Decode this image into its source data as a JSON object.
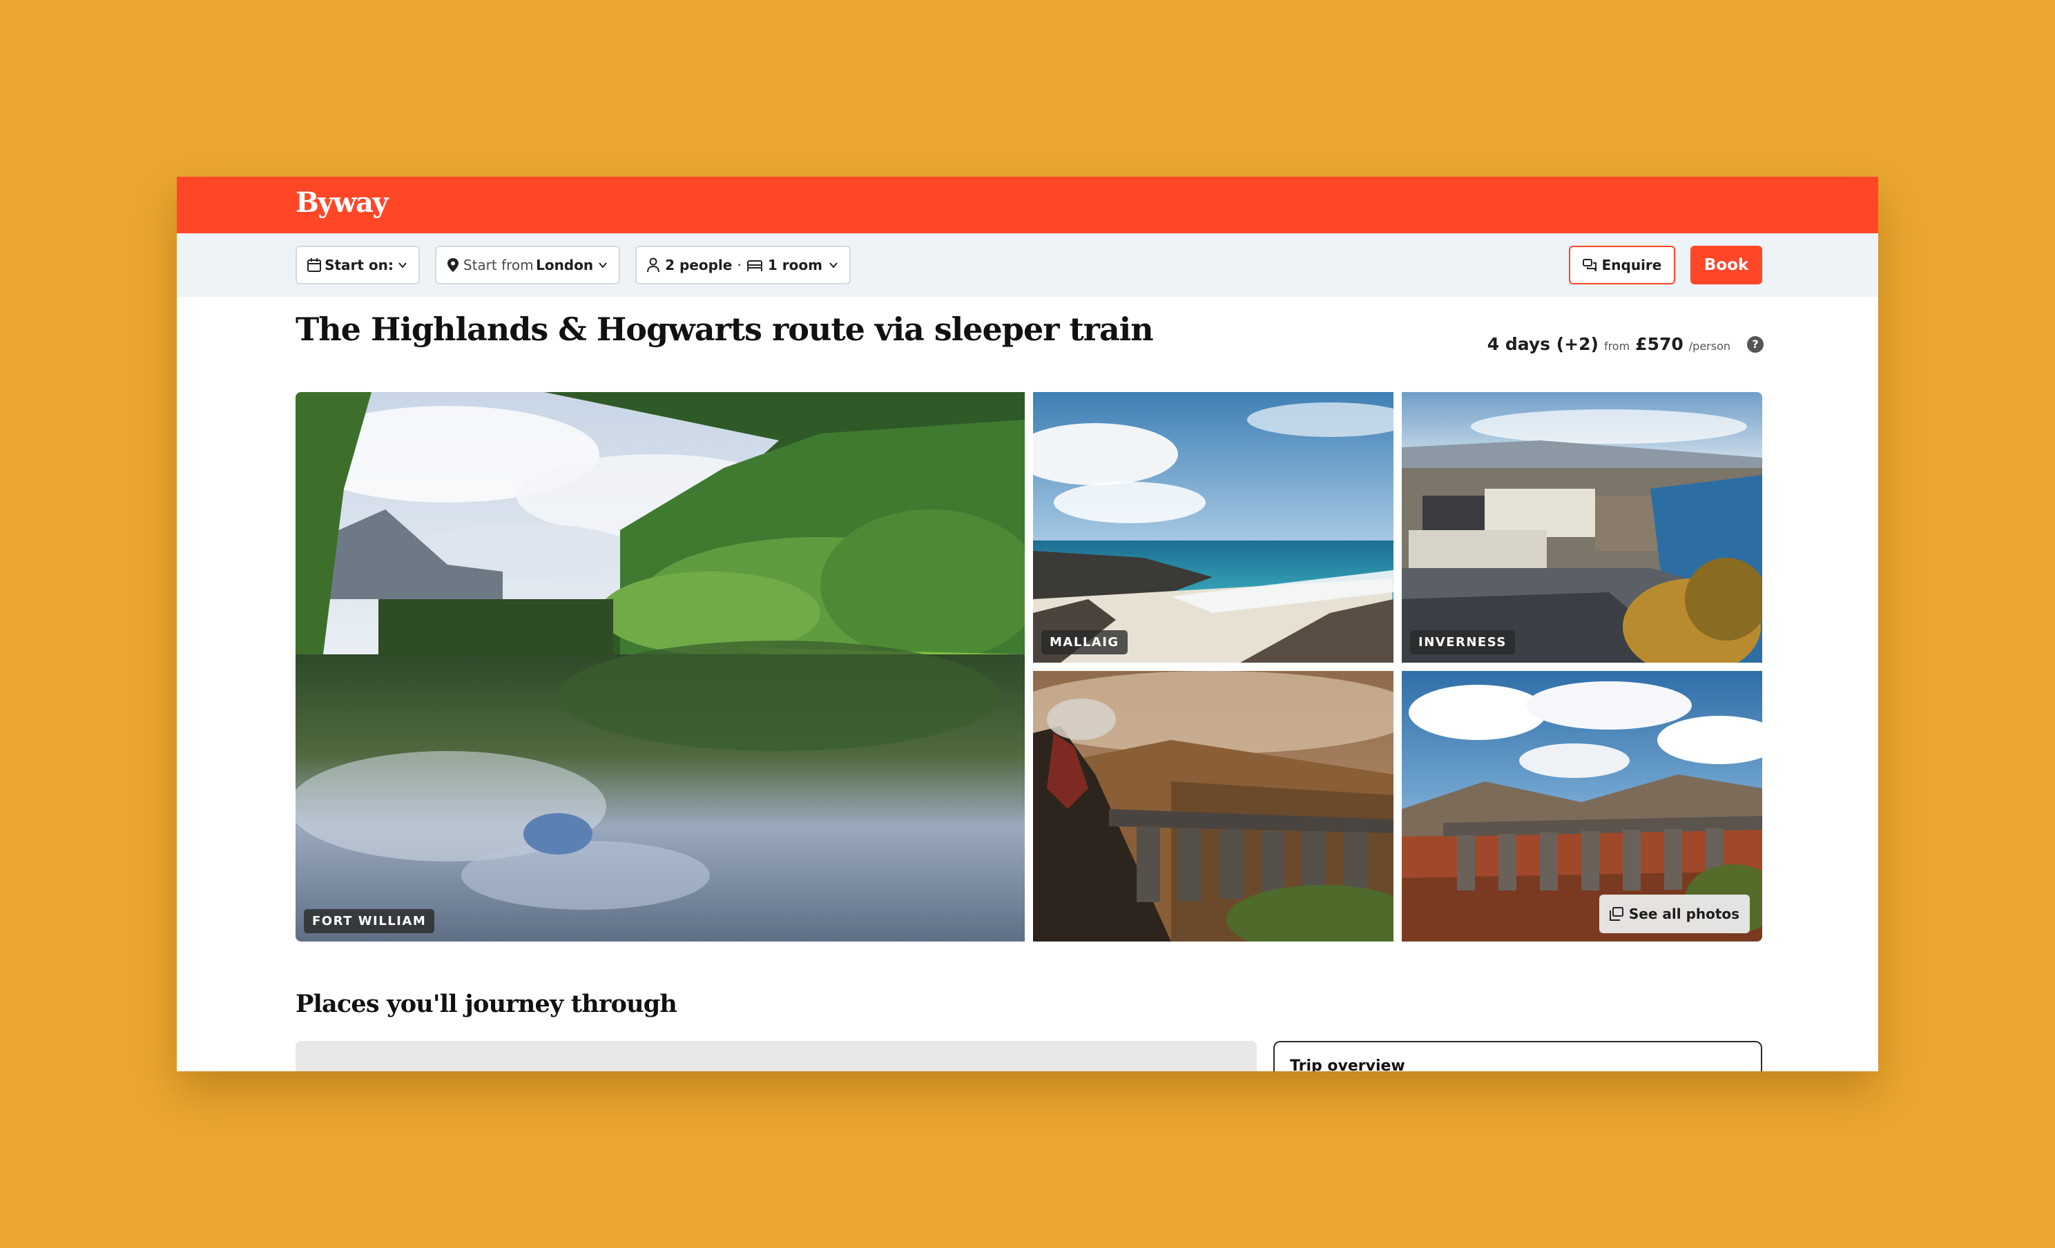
{
  "brand": {
    "logo": "Byway",
    "color": "#FF4728"
  },
  "filters": {
    "start_on": {
      "label": "Start on:",
      "icon": "calendar-icon"
    },
    "start_from": {
      "label": "Start from",
      "value": "London",
      "icon": "map-pin-icon"
    },
    "travellers": {
      "people": "2 people",
      "separator": "·",
      "rooms": "1 room",
      "icon": "person-icon",
      "room_icon": "bed-icon"
    }
  },
  "actions": {
    "enquire": "Enquire",
    "book": "Book"
  },
  "trip": {
    "title": "The Highlands & Hogwarts route via sleeper train",
    "duration": "4 days (+2)",
    "from_label": "from",
    "price": "£570",
    "per_label": "/person",
    "help": "?"
  },
  "gallery": {
    "main_label": "FORT WILLIAM",
    "tile_a_label": "MALLAIG",
    "tile_b_label": "INVERNESS",
    "see_all": "See all photos"
  },
  "sections": {
    "places_heading": "Places you'll journey through",
    "overview_label": "Trip overview"
  }
}
